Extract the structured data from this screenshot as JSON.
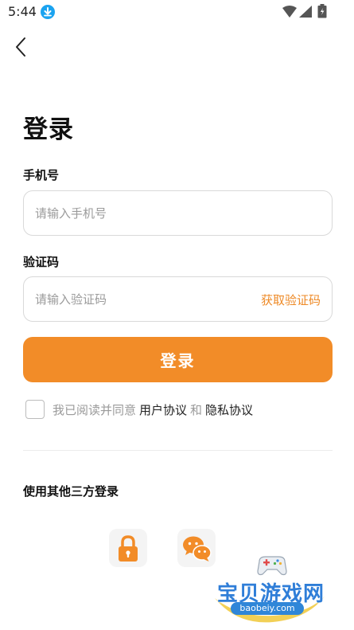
{
  "status_bar": {
    "time": "5:44",
    "icons": [
      "download-icon",
      "wifi-icon",
      "signal-icon",
      "battery-icon"
    ]
  },
  "nav": {
    "back_icon": "chevron-left-icon"
  },
  "title": "登录",
  "phone": {
    "label": "手机号",
    "placeholder": "请输入手机号",
    "value": ""
  },
  "code": {
    "label": "验证码",
    "placeholder": "请输入验证码",
    "value": "",
    "get_code_label": "获取验证码"
  },
  "login_button": "登录",
  "agreement": {
    "checked": false,
    "prefix": "我已阅读并同意",
    "user_agreement": "用户协议",
    "and": "和",
    "privacy_policy": "隐私协议"
  },
  "third_party": {
    "label": "使用其他三方登录",
    "options": [
      "lock-icon",
      "wechat-icon"
    ]
  },
  "watermark": {
    "text": "宝贝游戏网",
    "url": "baobeiy.com"
  },
  "colors": {
    "accent": "#f28c28",
    "link_accent": "#ee8a27",
    "watermark_blue": "#2f7ed8"
  }
}
